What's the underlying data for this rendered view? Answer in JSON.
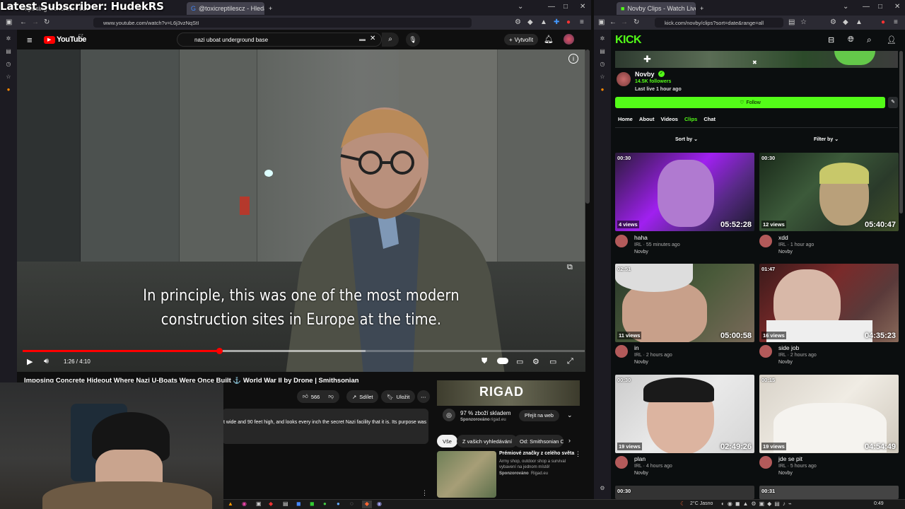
{
  "overlay": {
    "subscriber_text": "Latest Subscriber: HudekRS"
  },
  "left_browser": {
    "tabs": [
      {
        "label": "Imposing Concrete Hideout Wh"
      },
      {
        "label": "@toxicreptilescz - Hledat Goog"
      }
    ],
    "url": "www.youtube.com/watch?v=L6j3vzNqStI"
  },
  "youtube": {
    "logo": "YouTube",
    "logo_region": "CZ",
    "search_value": "nazi uboat underground base",
    "create_label": "Vytvořit",
    "caption_line1": "In principle, this was one of the most modern",
    "caption_line2": "construction sites in Europe at the time.",
    "progress": 0.35,
    "buffered": 0.61,
    "time": "1:26 / 4:10",
    "video_title": "Imposing Concrete Hideout Where Nazi U-Boats Were Once Built ⚓ World War II by Drone | Smithsonian",
    "like_count": "566",
    "share_label": "Sdílet",
    "save_label": "Uložit",
    "description": "t wide and 90 feet high, and looks every inch the secret Nazi facility that it is. Its purpose was",
    "ad": {
      "brand": "RIGAD",
      "headline": "97 % zboží skladem",
      "sponsored": "Sponzorováno",
      "domain": "rigad.eu",
      "cta": "Přejít na web"
    },
    "chips": [
      "Vše",
      "Z vašich vyhledávání",
      "Od: Smithsonian C"
    ],
    "rec": {
      "title": "Prémiové značky z celého světa",
      "desc": "Army shop, outdoor shop a survival vybavení na jednom místě!",
      "sponsored": "Sponzorováno",
      "domain": "Rigad.eu"
    }
  },
  "right_browser": {
    "tab": "Novby Clips - Watch Live on Ki",
    "url": "kick.com/novby/clips?sort=date&range=all"
  },
  "kick": {
    "logo": "KICK",
    "channel": "Novby",
    "followers": "14.5K followers",
    "last_live": "Last live 1 hour ago",
    "follow_label": "Follow",
    "nav": [
      "Home",
      "About",
      "Videos",
      "Clips",
      "Chat"
    ],
    "active_nav": "Clips",
    "sort_label": "Sort by",
    "filter_label": "Filter by",
    "clips": [
      {
        "duration": "00:30",
        "views": "4 views",
        "timestamp": "05:52:28",
        "title": "haha",
        "meta": "IRL · 55 minutes ago",
        "owner": "Novby"
      },
      {
        "duration": "00:30",
        "views": "12 views",
        "timestamp": "05:40:47",
        "title": "xdd",
        "meta": "IRL · 1 hour ago",
        "owner": "Novby"
      },
      {
        "duration": "02:51",
        "views": "11 views",
        "timestamp": "05:00:58",
        "title": "in",
        "meta": "IRL · 2 hours ago",
        "owner": "Novby"
      },
      {
        "duration": "01:47",
        "views": "16 views",
        "timestamp": "04:35:23",
        "title": "side job",
        "meta": "IRL · 2 hours ago",
        "owner": "Novby"
      },
      {
        "duration": "00:30",
        "views": "19 views",
        "timestamp": "02:49:26",
        "title": "plan",
        "meta": "IRL · 4 hours ago",
        "owner": "Novby"
      },
      {
        "duration": "00:15",
        "views": "19 views",
        "timestamp": "04:54:49",
        "title": "jde se pit",
        "meta": "IRL · 5 hours ago",
        "owner": "Novby"
      }
    ],
    "next_durations": [
      "00:30",
      "00:31"
    ]
  },
  "taskbar": {
    "weather": "2°C Jasno",
    "time": "0:49"
  },
  "colors": {
    "kick_green": "#53fc18",
    "yt_red": "#ff0000",
    "bg": "#0f0f0f"
  }
}
